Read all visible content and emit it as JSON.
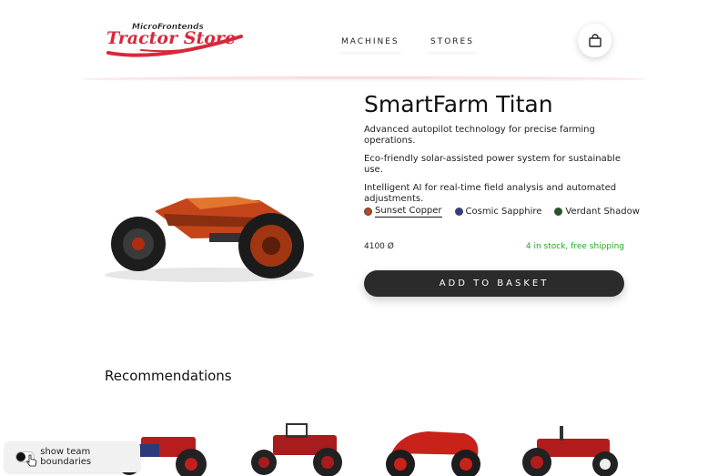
{
  "header": {
    "logo_top": "MicroFrontends",
    "logo_main": "Tractor Store",
    "nav": [
      "MACHINES",
      "STORES"
    ],
    "basket_icon": "shopping-bag-icon"
  },
  "product": {
    "name": "SmartFarm Titan",
    "highlights": [
      "Advanced autopilot technology for precise farming operations.",
      "Eco-friendly solar-assisted power system for sustainable use.",
      "Intelligent AI for real-time field analysis and automated adjustments."
    ],
    "variants": [
      {
        "label": "Sunset Copper",
        "color": "#c0451f",
        "selected": true
      },
      {
        "label": "Cosmic Sapphire",
        "color": "#2d3d8f",
        "selected": false
      },
      {
        "label": "Verdant Shadow",
        "color": "#1f5a24",
        "selected": false
      }
    ],
    "price": "4100 Ø",
    "stock": "4 in stock, free shipping",
    "add_button": "ADD TO BASKET"
  },
  "recommendations": {
    "heading": "Recommendations"
  },
  "toggle": {
    "label": "show team boundaries"
  },
  "colors": {
    "brand_red": "#d6293a",
    "stock_green": "#28a428",
    "button_dark": "#2b2b2b"
  }
}
